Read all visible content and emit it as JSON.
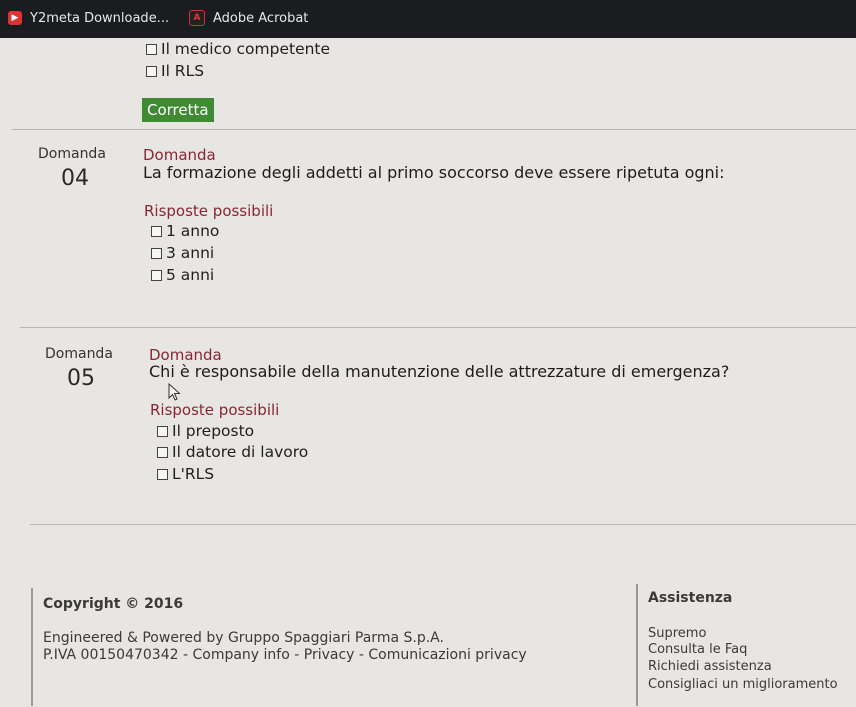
{
  "bookmarks": [
    {
      "label": "Y2meta Downloade...",
      "icon": "youtube-icon"
    },
    {
      "label": "Adobe Acrobat",
      "icon": "acrobat-icon"
    }
  ],
  "prev_question": {
    "options": [
      "Il medico competente",
      "Il RLS"
    ],
    "result_badge": "Corretta"
  },
  "questions": [
    {
      "label": "Domanda",
      "number": "04",
      "heading": "Domanda",
      "text": "La formazione degli addetti al primo soccorso deve essere ripetuta ogni:",
      "answers_heading": "Risposte possibili",
      "options": [
        "1 anno",
        "3 anni",
        "5 anni"
      ]
    },
    {
      "label": "Domanda",
      "number": "05",
      "heading": "Domanda",
      "text": "Chi è responsabile della manutenzione delle attrezzature di emergenza?",
      "answers_heading": "Risposte possibili",
      "options": [
        "Il preposto",
        "Il datore di lavoro",
        "L'RLS"
      ]
    }
  ],
  "footer": {
    "copyright": "Copyright © 2016",
    "powered": "Engineered & Powered by Gruppo Spaggiari Parma S.p.A.",
    "piva": "P.IVA 00150470342 - Company info - Privacy - Comunicazioni privacy",
    "assistance_title": "Assistenza",
    "assistance_links": [
      "Supremo",
      "Consulta le Faq",
      "Richiedi assistenza",
      "Consigliaci un miglioramento"
    ]
  },
  "colors": {
    "background": "#e7e6e2",
    "accent_red": "#8a2633",
    "correct_green": "#3f8a33",
    "bookmarks_bar": "#1b1c1f"
  }
}
